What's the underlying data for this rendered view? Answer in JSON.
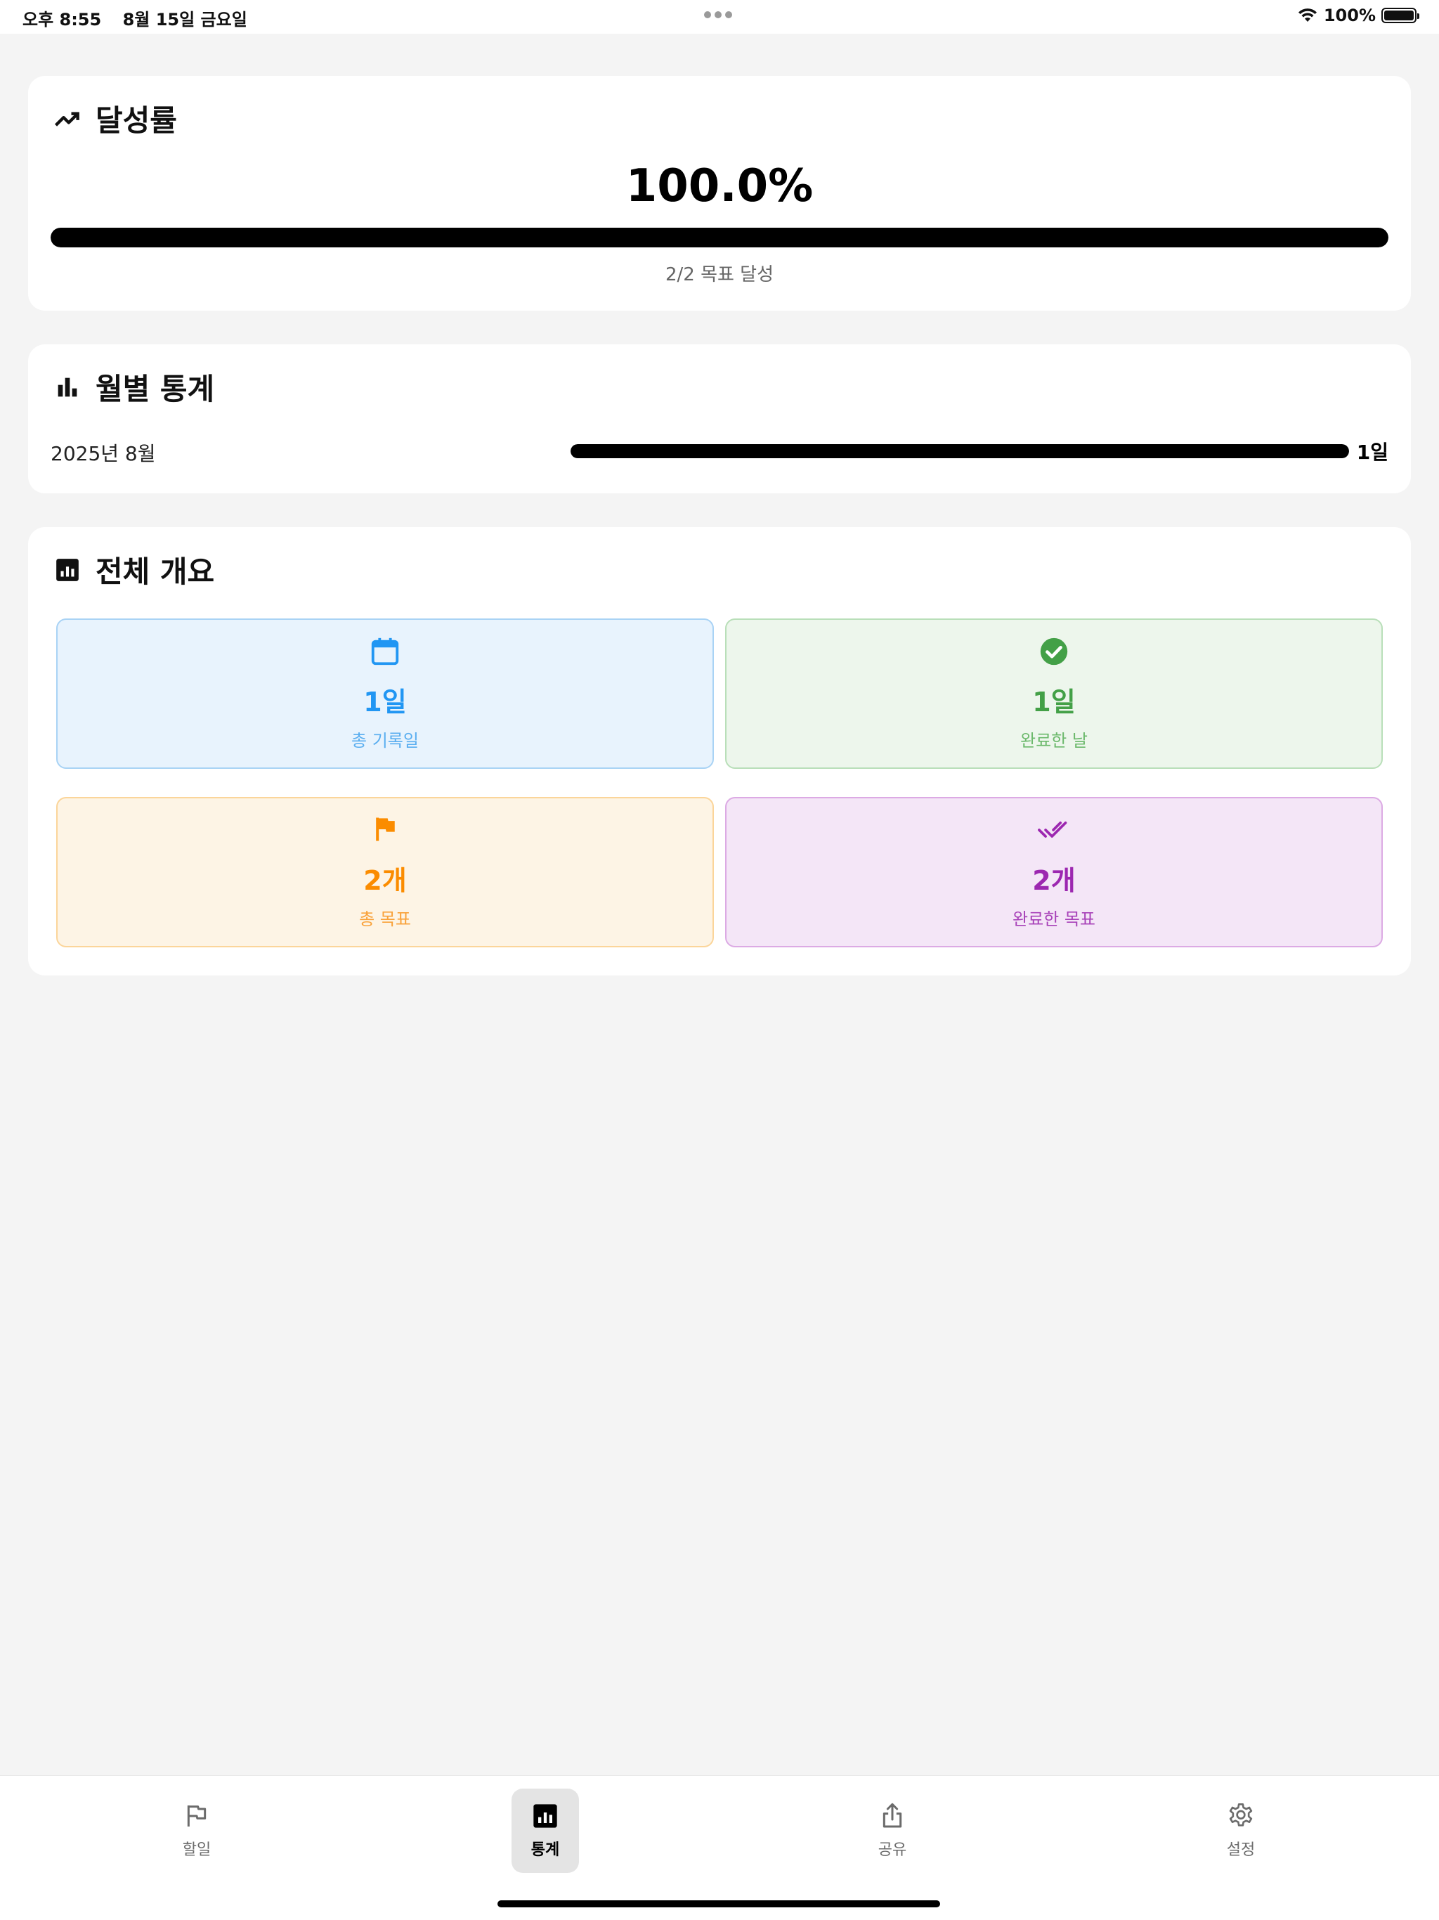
{
  "status_bar": {
    "time": "오후 8:55",
    "date": "8월 15일 금요일",
    "battery": "100%"
  },
  "achievement": {
    "title": "달성률",
    "percent_text": "100.0%",
    "progress": 1.0,
    "caption": "2/2 목표 달성"
  },
  "monthly": {
    "title": "월별 통계",
    "rows": [
      {
        "label": "2025년 8월",
        "value": "1일",
        "fill": 1.0
      }
    ]
  },
  "overview": {
    "title": "전체 개요",
    "tiles": {
      "total_days": {
        "value": "1일",
        "label": "총 기록일",
        "icon": "calendar-icon",
        "color": "#2196f3"
      },
      "done_days": {
        "value": "1일",
        "label": "완료한 날",
        "icon": "check-circle-icon",
        "color": "#43a047"
      },
      "total_goals": {
        "value": "2개",
        "label": "총 목표",
        "icon": "flag-icon",
        "color": "#fb8c00"
      },
      "done_goals": {
        "value": "2개",
        "label": "완료한 목표",
        "icon": "double-check-icon",
        "color": "#9c27b0"
      }
    }
  },
  "tabs": [
    {
      "label": "할일",
      "icon": "flag-outline-icon",
      "active": false
    },
    {
      "label": "통계",
      "icon": "chart-box-icon",
      "active": true
    },
    {
      "label": "공유",
      "icon": "share-icon",
      "active": false
    },
    {
      "label": "설정",
      "icon": "gear-icon",
      "active": false
    }
  ]
}
